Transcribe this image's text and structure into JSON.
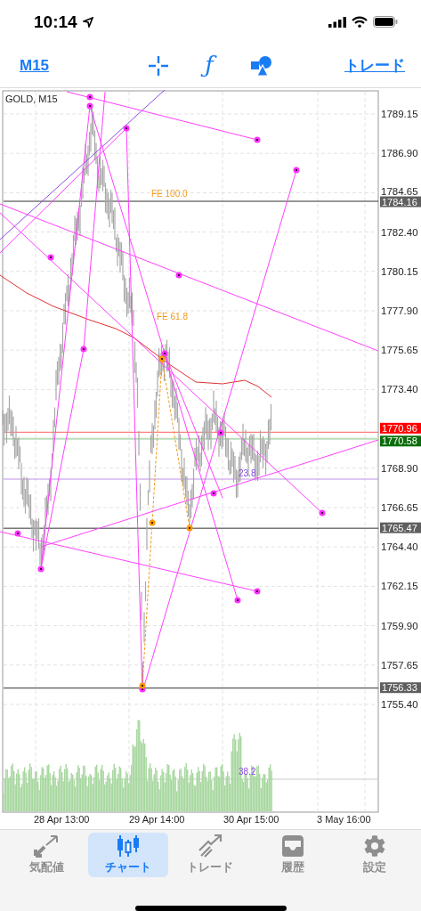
{
  "status_bar": {
    "time": "10:14"
  },
  "toolbar": {
    "timeframe": "M15",
    "indicator_glyph": "ƒ",
    "trade_link": "トレード"
  },
  "chart": {
    "symbol": "GOLD, M15",
    "price_labels": [
      "1789.15",
      "1786.90",
      "1784.65",
      "1782.40",
      "1780.15",
      "1777.90",
      "1775.65",
      "1773.40",
      "1768.90",
      "1766.65",
      "1764.40",
      "1762.15",
      "1759.90",
      "1757.65",
      "1755.40"
    ],
    "level_tags": [
      {
        "text": "1784.16",
        "color": "#5f5f5f"
      },
      {
        "text": "1770.96",
        "color": "#ff0000"
      },
      {
        "text": "1770.58",
        "color": "#0a6e0a"
      },
      {
        "text": "1765.47",
        "color": "#5f5f5f"
      },
      {
        "text": "1756.33",
        "color": "#5f5f5f"
      }
    ],
    "object_labels": [
      {
        "kind": "fibo",
        "text": "FE 100.0"
      },
      {
        "kind": "fibo",
        "text": "FE 61.8"
      },
      {
        "kind": "level",
        "text": "23.8"
      },
      {
        "kind": "level",
        "text": "38.2"
      }
    ],
    "time_labels": [
      "28 Apr 13:00",
      "29 Apr 14:00",
      "30 Apr 15:00",
      "3 May 16:00"
    ]
  },
  "tabs": [
    {
      "label": "気配値",
      "selected": false
    },
    {
      "label": "チャート",
      "selected": true
    },
    {
      "label": "トレード",
      "selected": false
    },
    {
      "label": "履歴",
      "selected": false
    },
    {
      "label": "設定",
      "selected": false
    }
  ]
}
